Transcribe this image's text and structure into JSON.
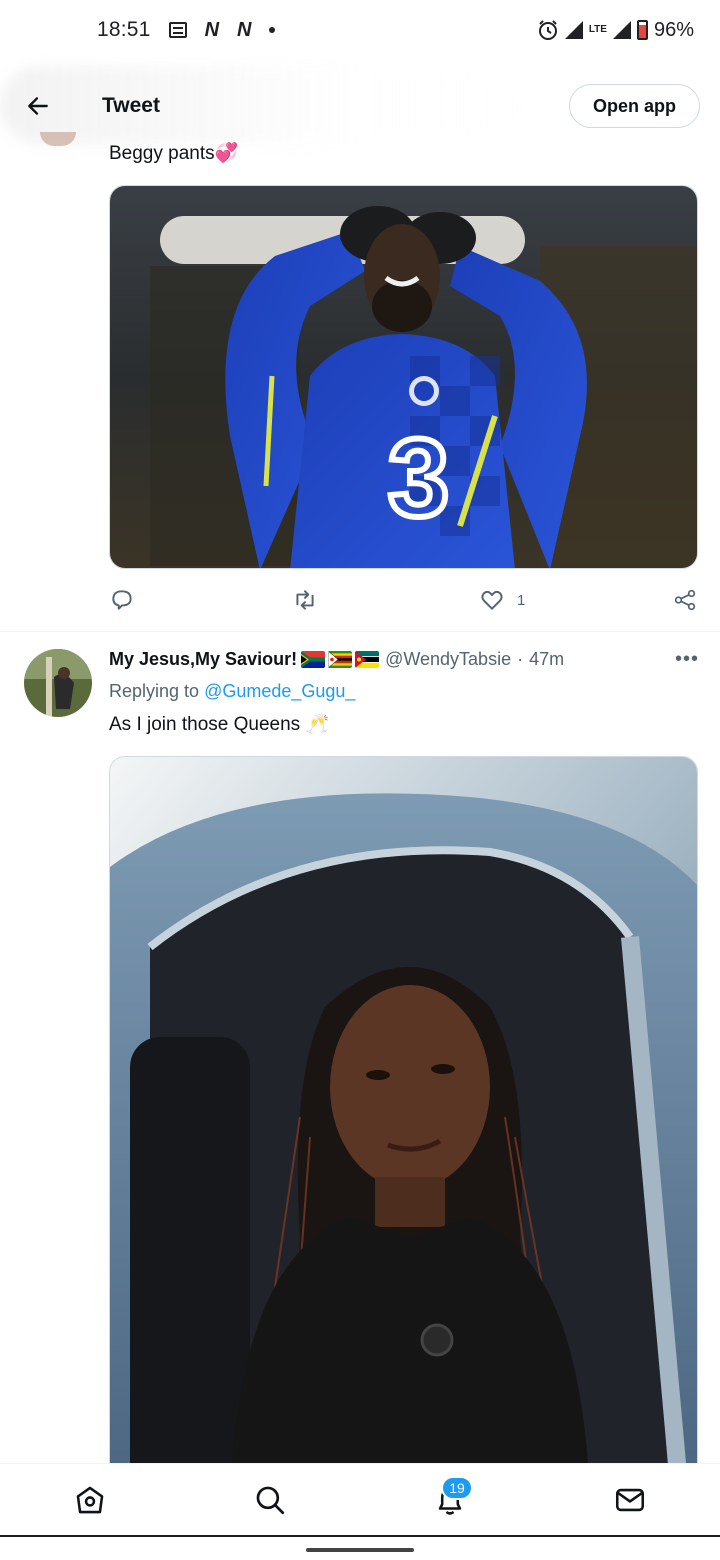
{
  "status_bar": {
    "time": "18:51",
    "network": "LTE",
    "battery": "96%",
    "battery_level": 0.96,
    "icons": [
      "notification-box-icon",
      "n-app-icon",
      "n-app-icon",
      "dot-icon",
      "alarm-icon",
      "signal-icon",
      "signal-icon",
      "battery-icon"
    ]
  },
  "header": {
    "title": "Tweet",
    "open_app_label": "Open app"
  },
  "tweets": [
    {
      "text": "Beggy pants💞",
      "media": "image",
      "actions": {
        "reply_count": "",
        "retweet_count": "",
        "like_count": "1"
      }
    },
    {
      "display_name": "My Jesus,My Saviour!",
      "flags": [
        "south-africa-flag",
        "zimbabwe-flag",
        "mozambique-flag"
      ],
      "handle": "@WendyTabsie",
      "separator": "·",
      "time": "47m",
      "more": "•••",
      "replying_prefix": "Replying to ",
      "replying_handle": "@Gumede_Gugu_",
      "text": "As I join those Queens 🥂",
      "media": "image"
    }
  ],
  "bottom_nav": {
    "items": [
      "home-icon",
      "search-icon",
      "notifications-icon",
      "messages-icon"
    ],
    "notifications_badge": "19"
  },
  "colors": {
    "accent": "#1d9bf0",
    "text": "#0f1419",
    "muted": "#536471",
    "border": "#cfd9de"
  }
}
